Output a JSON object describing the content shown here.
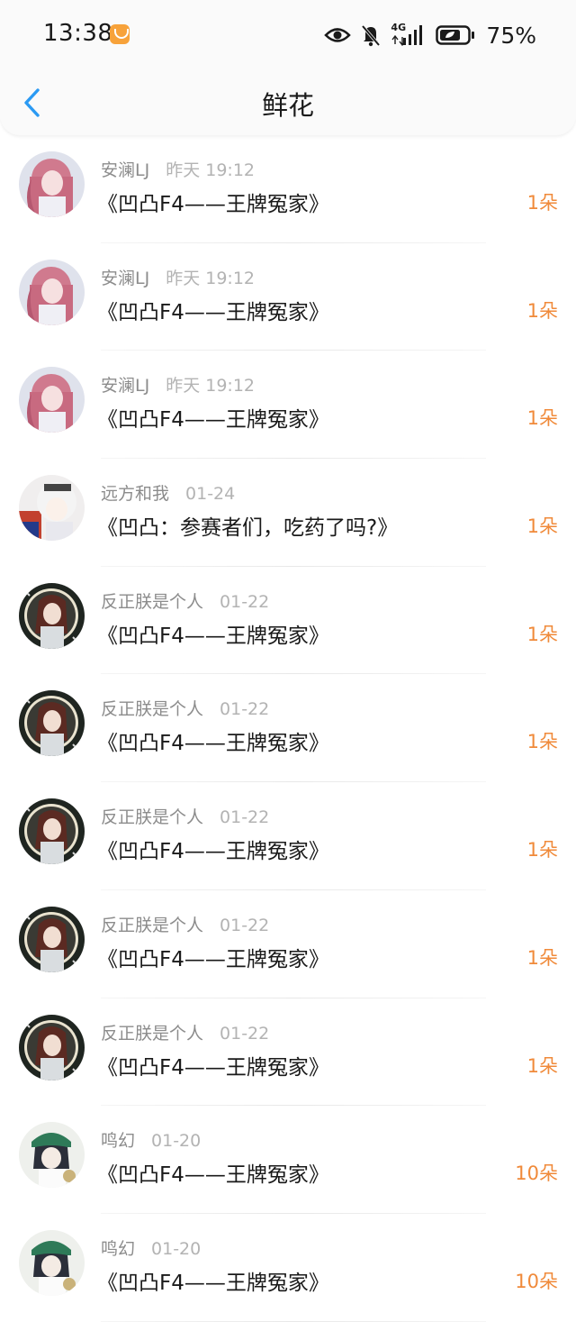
{
  "status_bar": {
    "time": "13:38",
    "network": "4G",
    "battery": "75%",
    "icons": [
      "app-badge-icon",
      "eye-icon",
      "mute-bell-icon",
      "signal-icon",
      "battery-icon"
    ]
  },
  "header": {
    "title": "鲜花",
    "back_icon": "chevron-left-icon"
  },
  "colors": {
    "accent_blue": "#2b9af3",
    "count_orange": "#f08a3a"
  },
  "items": [
    {
      "name": "安澜LJ",
      "time": "昨天 19:12",
      "title": "《凹凸F4——王牌冤家》",
      "count": "1朵",
      "avatar": "pink-hair-girl"
    },
    {
      "name": "安澜LJ",
      "time": "昨天 19:12",
      "title": "《凹凸F4——王牌冤家》",
      "count": "1朵",
      "avatar": "pink-hair-girl"
    },
    {
      "name": "安澜LJ",
      "time": "昨天 19:12",
      "title": "《凹凸F4——王牌冤家》",
      "count": "1朵",
      "avatar": "pink-hair-girl"
    },
    {
      "name": "远方和我",
      "time": "01-24",
      "title": "《凹凸：参赛者们，吃药了吗?》",
      "count": "1朵",
      "avatar": "white-hair-character"
    },
    {
      "name": "反正朕是个人",
      "time": "01-22",
      "title": "《凹凸F4——王牌冤家》",
      "count": "1朵",
      "avatar": "dark-red-hair-character"
    },
    {
      "name": "反正朕是个人",
      "time": "01-22",
      "title": "《凹凸F4——王牌冤家》",
      "count": "1朵",
      "avatar": "dark-red-hair-character"
    },
    {
      "name": "反正朕是个人",
      "time": "01-22",
      "title": "《凹凸F4——王牌冤家》",
      "count": "1朵",
      "avatar": "dark-red-hair-character"
    },
    {
      "name": "反正朕是个人",
      "time": "01-22",
      "title": "《凹凸F4——王牌冤家》",
      "count": "1朵",
      "avatar": "dark-red-hair-character"
    },
    {
      "name": "反正朕是个人",
      "time": "01-22",
      "title": "《凹凸F4——王牌冤家》",
      "count": "1朵",
      "avatar": "dark-red-hair-character"
    },
    {
      "name": "鸣幻",
      "time": "01-20",
      "title": "《凹凸F4——王牌冤家》",
      "count": "10朵",
      "avatar": "green-hat-character"
    },
    {
      "name": "鸣幻",
      "time": "01-20",
      "title": "《凹凸F4——王牌冤家》",
      "count": "10朵",
      "avatar": "green-hat-character"
    }
  ]
}
